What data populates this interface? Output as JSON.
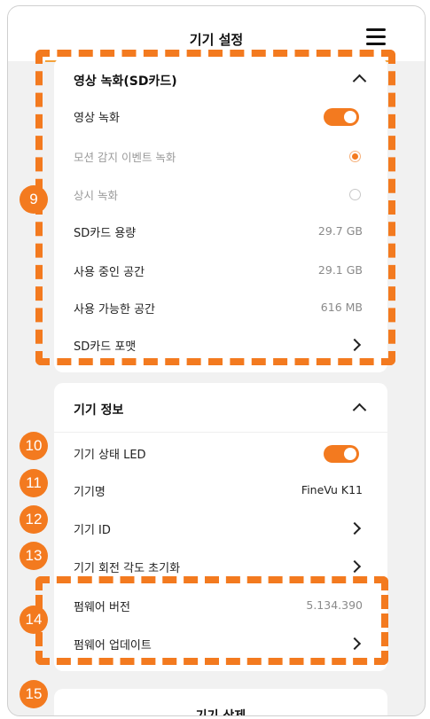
{
  "header": {
    "title": "기기 설정",
    "menu_icon": "hamburger-menu-icon"
  },
  "accent_color": "#f37a1f",
  "recording": {
    "title": "영상 녹화(SD카드)",
    "rows": {
      "video_recording": {
        "label": "영상 녹화",
        "enabled": true
      },
      "motion_event": {
        "label": "모션 감지 이벤트 녹화",
        "selected": true
      },
      "continuous": {
        "label": "상시 녹화",
        "selected": false
      },
      "sd_capacity": {
        "label": "SD카드 용량",
        "value": "29.7 GB"
      },
      "used_space": {
        "label": "사용 중인 공간",
        "value": "29.1 GB"
      },
      "available_space": {
        "label": "사용 가능한 공간",
        "value": "616 MB"
      },
      "sd_format": {
        "label": "SD카드 포맷"
      }
    }
  },
  "device_info": {
    "title": "기기 정보",
    "rows": {
      "status_led": {
        "label": "기기 상태 LED",
        "enabled": true
      },
      "device_name": {
        "label": "기기명",
        "value": "FineVu K11"
      },
      "device_id": {
        "label": "기기 ID"
      },
      "rotation_reset": {
        "label": "기기 회전 각도 초기화"
      },
      "firmware_version": {
        "label": "펌웨어 버전",
        "value": "5.134.390"
      },
      "firmware_update": {
        "label": "펌웨어 업데이트"
      }
    }
  },
  "delete_label": "기기 삭제",
  "badges": [
    "9",
    "10",
    "11",
    "12",
    "13",
    "14",
    "15"
  ]
}
